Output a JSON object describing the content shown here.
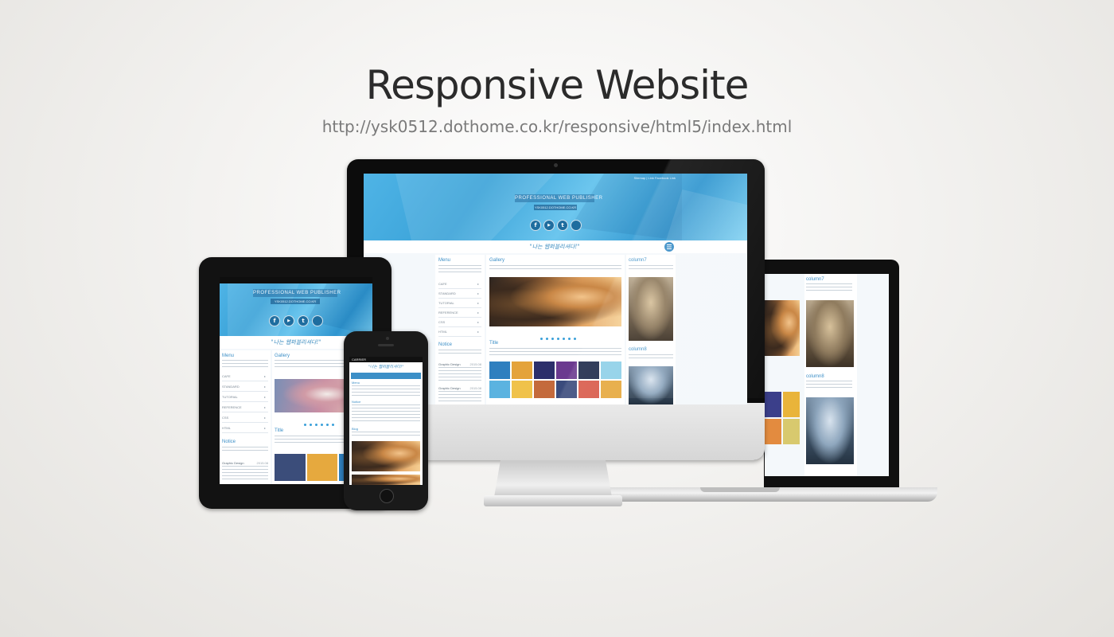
{
  "header": {
    "title": "Responsive Website",
    "url": "http://ysk0512.dothome.co.kr/responsive/html5/index.html"
  },
  "site": {
    "brand": "PROFESSIONAL WEB PUBLISHER",
    "subbrand": "YSK0512.DOTHOME.CO.KR",
    "slogan": "\"나는 웹퍼블리셔다!\"",
    "top_links": "Sitemap | Link   Facebook Link",
    "social_icons": [
      "facebook-icon",
      "youtube-icon",
      "twitch-icon",
      "apple-icon"
    ],
    "social_glyphs": [
      "f",
      "▶",
      "t",
      ""
    ],
    "menu_title": "Menu",
    "menu_items": [
      "CAFE",
      "STANDARD",
      "TUTORIAL",
      "REFERENCE",
      "CSS",
      "HTML"
    ],
    "menu_arrow": "▸",
    "gallery_title": "Gallery",
    "notice_title": "Notice",
    "notice_items": [
      "Graphic Design",
      "Graphic Design"
    ],
    "notice_dates": [
      "2015.08",
      "2015.08"
    ],
    "title_label": "Title",
    "column7": "column7",
    "column8": "column8",
    "blog_label": "Blog"
  },
  "iphone": {
    "carrier": "CARRIER"
  },
  "colors": {
    "accent": "#3c8fc7",
    "hero": "#3aa2d8",
    "device_black": "#0c0c0c"
  }
}
